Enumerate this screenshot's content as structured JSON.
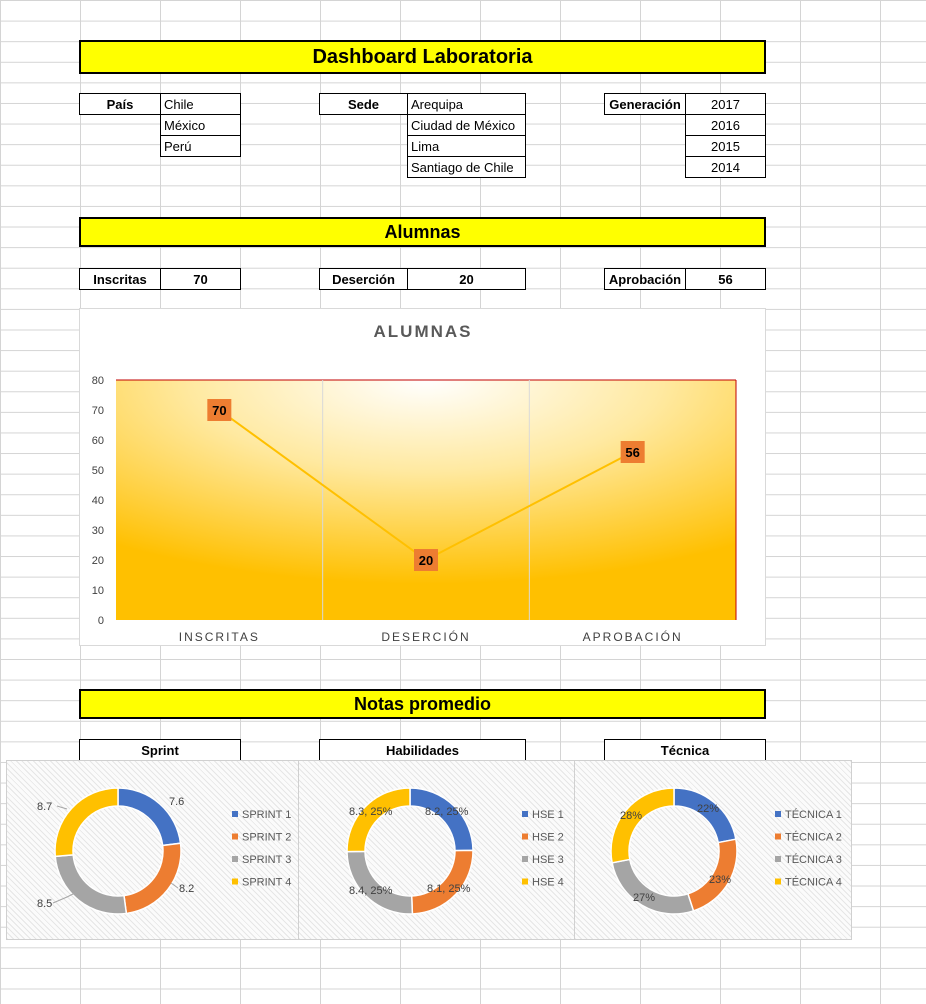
{
  "title": "Dashboard Laboratoria",
  "filters": {
    "pais": {
      "label": "País",
      "items": [
        "Chile",
        "México",
        "Perú"
      ]
    },
    "sede": {
      "label": "Sede",
      "items": [
        "Arequipa",
        "Ciudad de México",
        "Lima",
        "Santiago de Chile"
      ]
    },
    "generacion": {
      "label": "Generación",
      "items": [
        "2017",
        "2016",
        "2015",
        "2014"
      ]
    }
  },
  "alumnas_section": "Alumnas",
  "kpis": {
    "inscritas": {
      "label": "Inscritas",
      "value": "70"
    },
    "desercion": {
      "label": "Deserción",
      "value": "20"
    },
    "aprobacion": {
      "label": "Aprobación",
      "value": "56"
    }
  },
  "notas_section": "Notas promedio",
  "notas_headers": {
    "sprint": "Sprint",
    "habilidades": "Habilidades",
    "tecnica": "Técnica"
  },
  "colors": {
    "banner": "#ffff00",
    "line": "#ffc000",
    "marker": "#ed7d31",
    "plot_border": "#c00000"
  },
  "chart_data": [
    {
      "type": "line",
      "title": "ALUMNAS",
      "categories": [
        "INSCRITAS",
        "DESERCIÓN",
        "APROBACIÓN"
      ],
      "values": [
        70,
        20,
        56
      ],
      "ylim": [
        0,
        80
      ],
      "yticks": [
        0,
        10,
        20,
        30,
        40,
        50,
        60,
        70,
        80
      ],
      "grid": "vertical",
      "legend": "none"
    },
    {
      "type": "pie",
      "name": "sprint",
      "categories": [
        "SPRINT 1",
        "SPRINT 2",
        "SPRINT 3",
        "SPRINT 4"
      ],
      "values": [
        7.6,
        8.2,
        8.5,
        8.7
      ],
      "labels": [
        "7.6",
        "8.2",
        "8.5",
        "8.7"
      ],
      "colors": [
        "#4472c4",
        "#ed7d31",
        "#a5a5a5",
        "#ffc000"
      ],
      "legend": "right"
    },
    {
      "type": "pie",
      "name": "habilidades",
      "categories": [
        "HSE 1",
        "HSE 2",
        "HSE 3",
        "HSE 4"
      ],
      "values": [
        8.2,
        8.1,
        8.4,
        8.3
      ],
      "labels": [
        "8.2, 25%",
        "8.1, 25%",
        "8.4, 25%",
        "8.3, 25%"
      ],
      "colors": [
        "#4472c4",
        "#ed7d31",
        "#a5a5a5",
        "#ffc000"
      ],
      "legend": "right"
    },
    {
      "type": "pie",
      "name": "tecnica",
      "categories": [
        "TÉCNICA 1",
        "TÉCNICA 2",
        "TÉCNICA 3",
        "TÉCNICA 4"
      ],
      "values": [
        22,
        23,
        27,
        28
      ],
      "labels": [
        "22%",
        "23%",
        "27%",
        "28%"
      ],
      "colors": [
        "#4472c4",
        "#ed7d31",
        "#a5a5a5",
        "#ffc000"
      ],
      "legend": "right"
    }
  ]
}
